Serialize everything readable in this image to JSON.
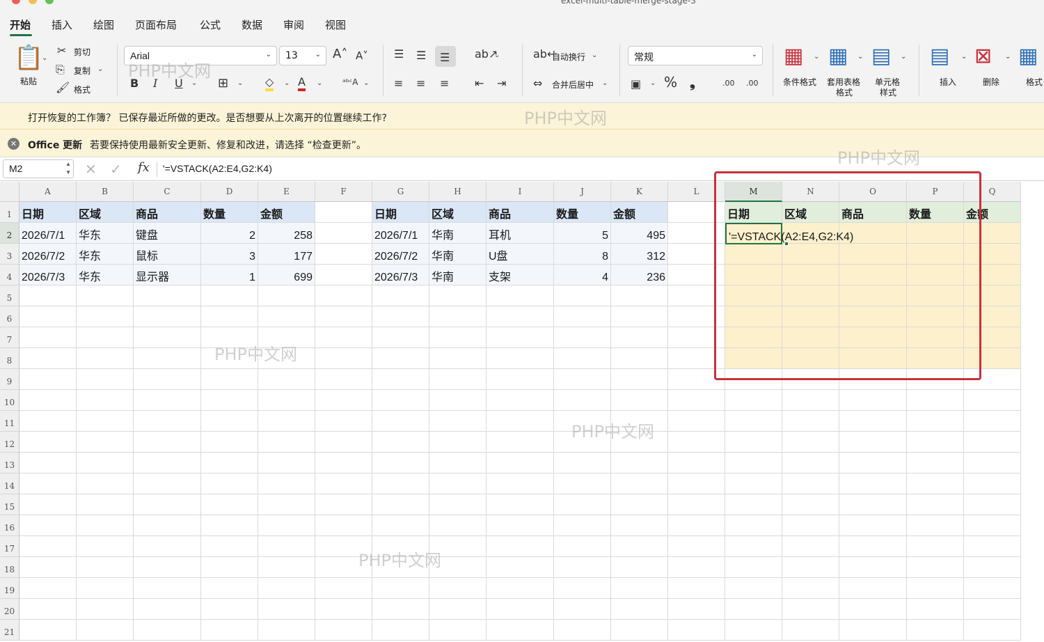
{
  "window": {
    "title": "excel-multi-table-merge-stage-3"
  },
  "tabs": [
    {
      "label": "开始"
    },
    {
      "label": "插入"
    },
    {
      "label": "绘图"
    },
    {
      "label": "页面布局"
    },
    {
      "label": "公式"
    },
    {
      "label": "数据"
    },
    {
      "label": "审阅"
    },
    {
      "label": "视图"
    }
  ],
  "ribbon": {
    "paste": "粘贴",
    "cut": "剪切",
    "copy": "复制",
    "format_painter": "格式",
    "font_name": "Arial",
    "font_size": "13",
    "bold": "B",
    "italic": "I",
    "underline": "U",
    "wrap_text": "自动换行",
    "merge_center": "合并后居中",
    "number_format": "常规",
    "percent": "%",
    "comma": "❟",
    "dec_inc": ".00",
    "dec_dec": ".00",
    "conditional_format": "条件格式",
    "format_as_table_line1": "套用表格",
    "format_as_table_line2": "格式",
    "cell_styles_line1": "单元格",
    "cell_styles_line2": "样式",
    "insert": "插入",
    "delete": "删除",
    "format": "格式"
  },
  "notifications": {
    "recovery": "打开恢复的工作簿？ 已保存最近所做的更改。是否想要从上次离开的位置继续工作?",
    "update_title": "Office 更新",
    "update_text": "若要保持使用最新安全更新、修复和改进，请选择 “检查更新”。"
  },
  "formula_bar": {
    "name_box": "M2",
    "formula": "'=VSTACK(A2:E4,G2:K4)"
  },
  "sheet": {
    "columns": [
      "A",
      "B",
      "C",
      "D",
      "E",
      "F",
      "G",
      "H",
      "I",
      "J",
      "K",
      "L",
      "M",
      "N",
      "O",
      "P",
      "Q"
    ],
    "rows": [
      "1",
      "2",
      "3",
      "4",
      "5",
      "6",
      "7",
      "8",
      "9",
      "10",
      "11",
      "12",
      "13",
      "14",
      "15",
      "16",
      "17",
      "18",
      "19",
      "20",
      "21"
    ],
    "table1": {
      "headers": [
        "日期",
        "区域",
        "商品",
        "数量",
        "金额"
      ],
      "rows": [
        [
          "2026/7/1",
          "华东",
          "键盘",
          "2",
          "258"
        ],
        [
          "2026/7/2",
          "华东",
          "鼠标",
          "3",
          "177"
        ],
        [
          "2026/7/3",
          "华东",
          "显示器",
          "1",
          "699"
        ]
      ]
    },
    "table2": {
      "headers": [
        "日期",
        "区域",
        "商品",
        "数量",
        "金额"
      ],
      "rows": [
        [
          "2026/7/1",
          "华南",
          "耳机",
          "5",
          "495"
        ],
        [
          "2026/7/2",
          "华南",
          "U盘",
          "8",
          "312"
        ],
        [
          "2026/7/3",
          "华南",
          "支架",
          "4",
          "236"
        ]
      ]
    },
    "result_headers": [
      "日期",
      "区域",
      "商品",
      "数量",
      "金额"
    ],
    "result_formula": "'=VSTACK(A2:E4,G2:K4)",
    "active_cell": "M2"
  },
  "watermark": "PHP中文网",
  "colors": {
    "accent": "#217346",
    "highlight": "#c8313b",
    "header_blue": "#dbe7f6",
    "result_yellow": "#fdf0cc",
    "result_green": "#e1eedb"
  }
}
